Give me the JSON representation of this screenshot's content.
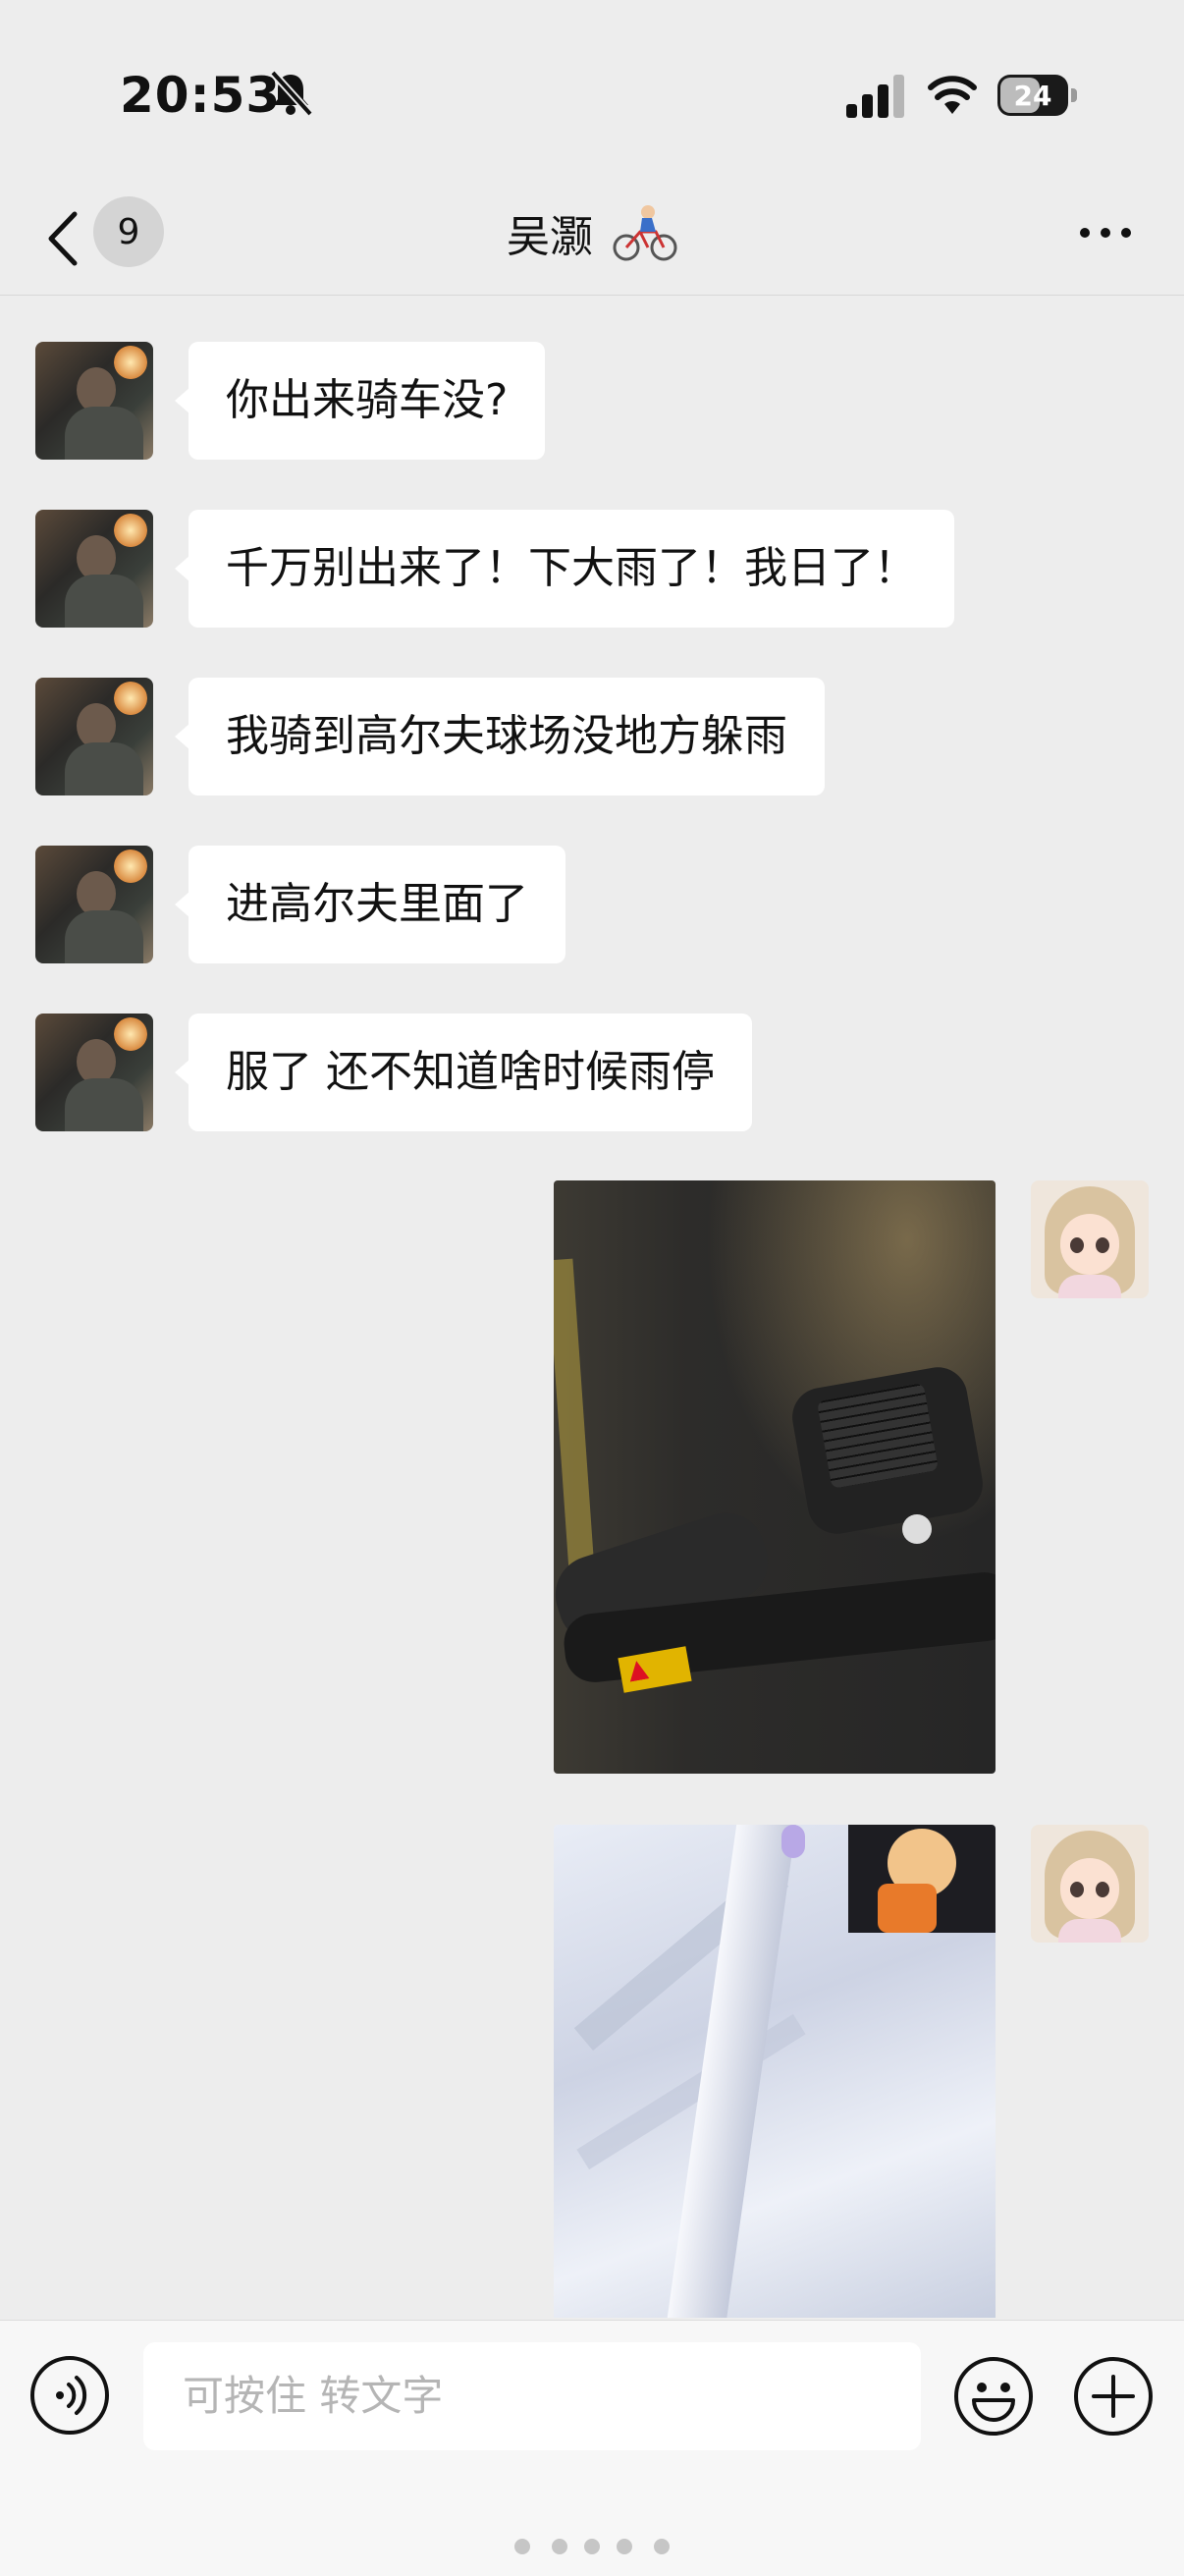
{
  "status_bar": {
    "time": "20:53",
    "battery": "24",
    "icons": [
      "bell-muted-icon",
      "signal-icon",
      "wifi-icon",
      "battery-icon"
    ]
  },
  "nav": {
    "back_icon": "chevron-left-icon",
    "unread_count": "9",
    "title": "吴灏",
    "title_emoji": "🚴",
    "more_icon": "more-dots-icon"
  },
  "messages": [
    {
      "sender": "contact",
      "text": "你出来骑车没?"
    },
    {
      "sender": "contact",
      "text": "千万别出来了！下大雨了！我日了！"
    },
    {
      "sender": "contact",
      "text": "我骑到高尔夫球场没地方躲雨"
    },
    {
      "sender": "contact",
      "text": "进高尔夫里面了"
    },
    {
      "sender": "contact",
      "text": "服了 还不知道啥时候雨停"
    },
    {
      "sender": "me",
      "type": "image",
      "content": "wet-bike-handlebar-photo"
    },
    {
      "sender": "me",
      "type": "image",
      "content": "white-fabric-photo"
    }
  ],
  "input": {
    "placeholder": "可按住 转文字",
    "voice_icon": "voice-input-icon",
    "emoji_icon": "emoji-icon",
    "plus_icon": "plus-icon"
  }
}
